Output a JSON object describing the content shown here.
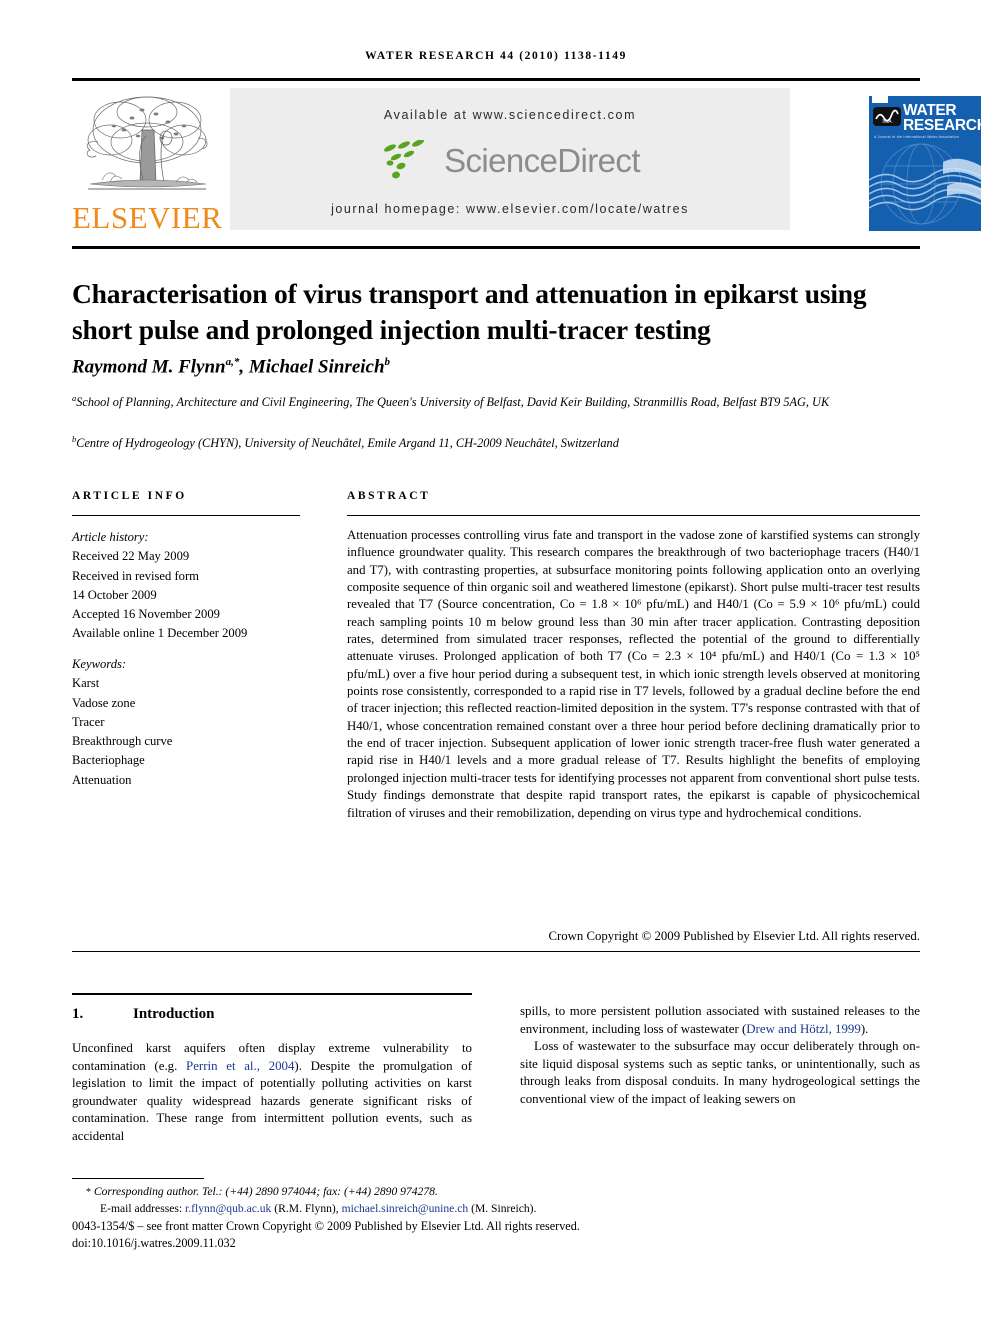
{
  "running_head": "WATER RESEARCH 44 (2010) 1138-1149",
  "masthead": {
    "publisher_name": "ELSEVIER",
    "publisher_logo_icon": "elsevier-tree-icon",
    "available_at": "Available at www.sciencedirect.com",
    "sciencedirect_logo_icon": "sciencedirect-leaf-icon",
    "sciencedirect_wordmark": "ScienceDirect",
    "journal_homepage": "journal homepage: www.elsevier.com/locate/watres",
    "band_color": "#ededed",
    "elsevier_orange": "#F08A1B",
    "sciencedirect_green": "#5AA31E",
    "sciencedirect_gray": "#8a8d8f"
  },
  "cover": {
    "title_line1": "WATER",
    "title_line2": "RESEARCH",
    "subtitle": "A Journal of the International Water Association",
    "iwa_logo_icon": "iwa-logo-icon",
    "background_color": "#1560AE"
  },
  "article": {
    "title": "Characterisation of virus transport and attenuation in epikarst using short pulse and prolonged injection multi-tracer testing",
    "authors_html": "Raymond M. Flynn<sup>a,</sup><sup>*</sup>, Michael Sinreich<sup>b</sup>",
    "affiliation_a": "School of Planning, Architecture and Civil Engineering, The Queen's University of Belfast, David Keir Building, Stranmillis Road, Belfast BT9 5AG, UK",
    "affiliation_b": "Centre of Hydrogeology (CHYN), University of Neuchâtel, Emile Argand 11, CH-2009 Neuchâtel, Switzerland"
  },
  "article_info": {
    "heading": "ARTICLE INFO",
    "history_label": "Article history:",
    "history": [
      "Received 22 May 2009",
      "Received in revised form",
      "14 October 2009",
      "Accepted 16 November 2009",
      "Available online 1 December 2009"
    ],
    "keywords_label": "Keywords:",
    "keywords": [
      "Karst",
      "Vadose zone",
      "Tracer",
      "Breakthrough curve",
      "Bacteriophage",
      "Attenuation"
    ]
  },
  "abstract": {
    "heading": "ABSTRACT",
    "text": "Attenuation processes controlling virus fate and transport in the vadose zone of karstified systems can strongly influence groundwater quality. This research compares the breakthrough of two bacteriophage tracers (H40/1 and T7), with contrasting properties, at subsurface monitoring points following application onto an overlying composite sequence of thin organic soil and weathered limestone (epikarst). Short pulse multi-tracer test results revealed that T7 (Source concentration, Co = 1.8 × 10⁶ pfu/mL) and H40/1 (Co = 5.9 × 10⁶ pfu/mL) could reach sampling points 10 m below ground less than 30 min after tracer application. Contrasting deposition rates, determined from simulated tracer responses, reflected the potential of the ground to differentially attenuate viruses. Prolonged application of both T7 (Co = 2.3 × 10⁴ pfu/mL) and H40/1 (Co = 1.3 × 10⁵ pfu/mL) over a five hour period during a subsequent test, in which ionic strength levels observed at monitoring points rose consistently, corresponded to a rapid rise in T7 levels, followed by a gradual decline before the end of tracer injection; this reflected reaction-limited deposition in the system. T7's response contrasted with that of H40/1, whose concentration remained constant over a three hour period before declining dramatically prior to the end of tracer injection. Subsequent application of lower ionic strength tracer-free flush water generated a rapid rise in H40/1 levels and a more gradual release of T7. Results highlight the benefits of employing prolonged injection multi-tracer tests for identifying processes not apparent from conventional short pulse tests. Study findings demonstrate that despite rapid transport rates, the epikarst is capable of physicochemical filtration of viruses and their remobilization, depending on virus type and hydrochemical conditions.",
    "copyright": "Crown Copyright © 2009 Published by Elsevier Ltd. All rights reserved."
  },
  "section": {
    "number": "1.",
    "title": "Introduction",
    "left_para1_pre": "Unconfined karst aquifers often display extreme vulnerability to contamination (e.g. ",
    "left_para1_link": "Perrin et al., 2004",
    "left_para1_post": "). Despite the promulgation of legislation to limit the impact of potentially polluting activities on karst groundwater quality widespread hazards generate significant risks of contamination. These range from intermittent pollution events, such as accidental",
    "right_para1_pre": "spills, to more persistent pollution associated with sustained releases to the environment, including loss of wastewater (",
    "right_para1_link": "Drew and Hötzl, 1999",
    "right_para1_post": ").",
    "right_para2": "Loss of wastewater to the subsurface may occur deliberately through on-site liquid disposal systems such as septic tanks, or unintentionally, such as through leaks from disposal conduits. In many hydrogeological settings the conventional view of the impact of leaking sewers on"
  },
  "footnote": {
    "star": "*",
    "corresponding": "Corresponding author. Tel.: (+44) 2890 974044; fax: (+44) 2890 974278.",
    "email_label": "E-mail addresses:",
    "email1": "r.flynn@qub.ac.uk",
    "email1_name": "(R.M. Flynn),",
    "email2": "michael.sinreich@unine.ch",
    "email2_name": "(M. Sinreich).",
    "issn_line": "0043-1354/$ – see front matter Crown Copyright © 2009 Published by Elsevier Ltd. All rights reserved.",
    "doi": "doi:10.1016/j.watres.2009.11.032",
    "link_color": "#1a3a8f"
  }
}
